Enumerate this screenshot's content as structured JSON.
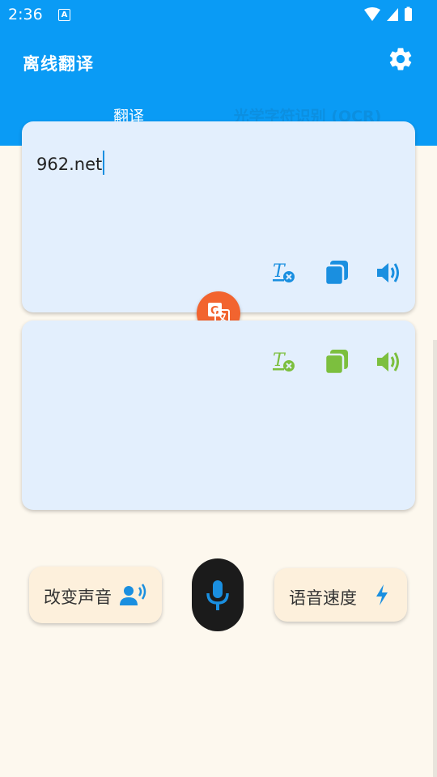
{
  "status_bar": {
    "time": "2:36",
    "notification_icon": "A"
  },
  "app_bar": {
    "title": "离线翻译",
    "settings_icon": "gear-icon"
  },
  "tabs": [
    {
      "label": "翻译",
      "selected": true
    },
    {
      "label": "光学字符识别 (OCR)",
      "selected": false
    }
  ],
  "source_card": {
    "text": "962.net",
    "icons": [
      "clear-text-icon",
      "copy-icon",
      "speaker-icon"
    ],
    "icon_color": "#1a8fe0"
  },
  "target_card": {
    "text": "",
    "icons": [
      "clear-text-icon",
      "copy-icon",
      "speaker-icon"
    ],
    "icon_color": "#7cbf3e"
  },
  "swap_button": {
    "icon": "translate-icon",
    "color": "#f2642f"
  },
  "bottom_bar": {
    "change_voice_label": "改变声音",
    "voice_speed_label": "语音速度",
    "mic_icon": "mic-icon"
  },
  "colors": {
    "primary": "#0a9bf5",
    "background": "#fdf8ee",
    "card": "#e3effd"
  }
}
